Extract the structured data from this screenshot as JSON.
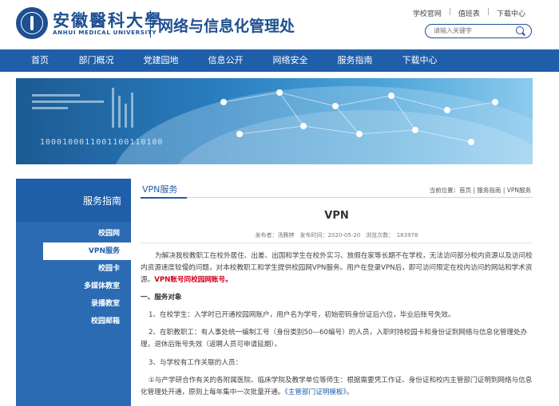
{
  "header": {
    "university_cn": "安徽醫科大學",
    "university_en": "ANHUI MEDICAL UNIVERSITY",
    "department": "网络与信息化管理处",
    "top_links": [
      "学校官网",
      "值班表",
      "下载中心"
    ],
    "search_placeholder": "请输入关键字"
  },
  "nav": {
    "items": [
      "首页",
      "部门概况",
      "党建园地",
      "信息公开",
      "网络安全",
      "服务指南",
      "下载中心"
    ]
  },
  "banner": {
    "binary_text": "1000100011001100110100"
  },
  "sidebar": {
    "title": "服务指南",
    "items": [
      "校园网",
      "VPN服务",
      "校园卡",
      "多媒体教室",
      "录播教室",
      "校园邮箱"
    ],
    "active": "VPN服务"
  },
  "content": {
    "section_title": "VPN服务",
    "breadcrumb": "当前位置：首页 | 服务指南 | VPN服务",
    "article_title": "VPN",
    "meta": "发布者：汤腾婷　发布时间：2020-05-20　浏览次数：　183978",
    "p1": "为解决我校教职工在校外居住、出差、出国和学生在校外实习、放假在家等长期不在学校，无法访问部分校内资源以及访问校内资源速度较慢的问题，对本校教职工和学生提供校园网VPN服务。用户在登录VPN后，即可访问限定在校内访问的网站和学术资源。",
    "p1_red": "VPN账号同校园网账号。",
    "h1": "一、服务对象",
    "item1": "1、在校学生：入学时已开通校园网账户，用户名为学号，初始密码身份证后六位，毕业后账号失效。",
    "item2": "2、在职教职工：有人事处统一编制工号（身份类别50—60编号）的人员，入职时持校园卡和身份证到网络与信息化管理处办理，退休后账号失效（返聘人员可申请延期）。",
    "item3": "3、与学校有工作关联的人员：",
    "item3a": "①与产学研合作有关的各附属医院、临床学院及教学单位等师生：根据需要凭工作证、身份证和校内主管部门证明到网络与信息化管理处开通，原则上每年集中一次批量开通。",
    "item3a_link": "《主管部门证明模板》",
    "item3a_end": "。"
  },
  "colors": {
    "brand_blue": "#1f5ea8",
    "dark_blue": "#1d4f91",
    "accent_red": "#d0021b"
  }
}
